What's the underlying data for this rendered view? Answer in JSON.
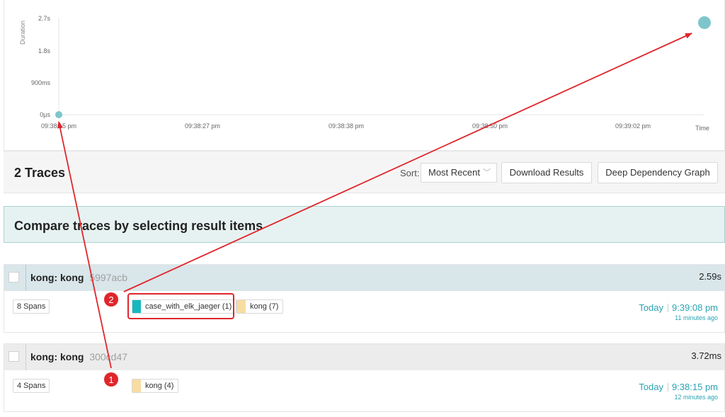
{
  "chart": {
    "ylabel": "Duration",
    "yticks": [
      "2.7s",
      "1.8s",
      "900ms",
      "0µs"
    ],
    "xticks": [
      "09:38:15 pm",
      "09:38:27 pm",
      "09:38:38 pm",
      "09:38:50 pm",
      "09:39:02 pm"
    ],
    "xlabel": "Time",
    "point_color": "#7ec6cc"
  },
  "chart_data": {
    "type": "scatter",
    "ylabel": "Duration",
    "xlabel": "Time",
    "yticks": [
      "0µs",
      "900ms",
      "1.8s",
      "2.7s"
    ],
    "xticks": [
      "09:38:15 pm",
      "09:38:27 pm",
      "09:38:38 pm",
      "09:38:50 pm",
      "09:39:02 pm"
    ],
    "points": [
      {
        "x": "09:38:15 pm",
        "y_ms": 3.72
      },
      {
        "x": "09:39:08 pm",
        "y_ms": 2590
      }
    ]
  },
  "results": {
    "title": "2 Traces",
    "sort_label": "Sort:",
    "sort_value": "Most Recent",
    "download_label": "Download Results",
    "ddg_label": "Deep Dependency Graph"
  },
  "compare": {
    "text": "Compare traces by selecting result items"
  },
  "traces": [
    {
      "name": "kong: kong",
      "id": "5997acb",
      "duration": "2.59s",
      "spans": "8 Spans",
      "services": [
        {
          "label": "case_with_elk_jaeger (1)",
          "color": "#17b8be"
        },
        {
          "label": "kong (7)",
          "color": "#f8dcA1"
        }
      ],
      "today": "Today",
      "time": "9:39:08 pm",
      "ago": "11 minutes ago"
    },
    {
      "name": "kong: kong",
      "id": "300cd47",
      "duration": "3.72ms",
      "spans": "4 Spans",
      "services": [
        {
          "label": "kong (4)",
          "color": "#f8dca1"
        }
      ],
      "today": "Today",
      "time": "9:38:15 pm",
      "ago": "12 minutes ago"
    }
  ],
  "annotations": {
    "badge1": "1",
    "badge2": "2",
    "color": "#e0262b"
  }
}
